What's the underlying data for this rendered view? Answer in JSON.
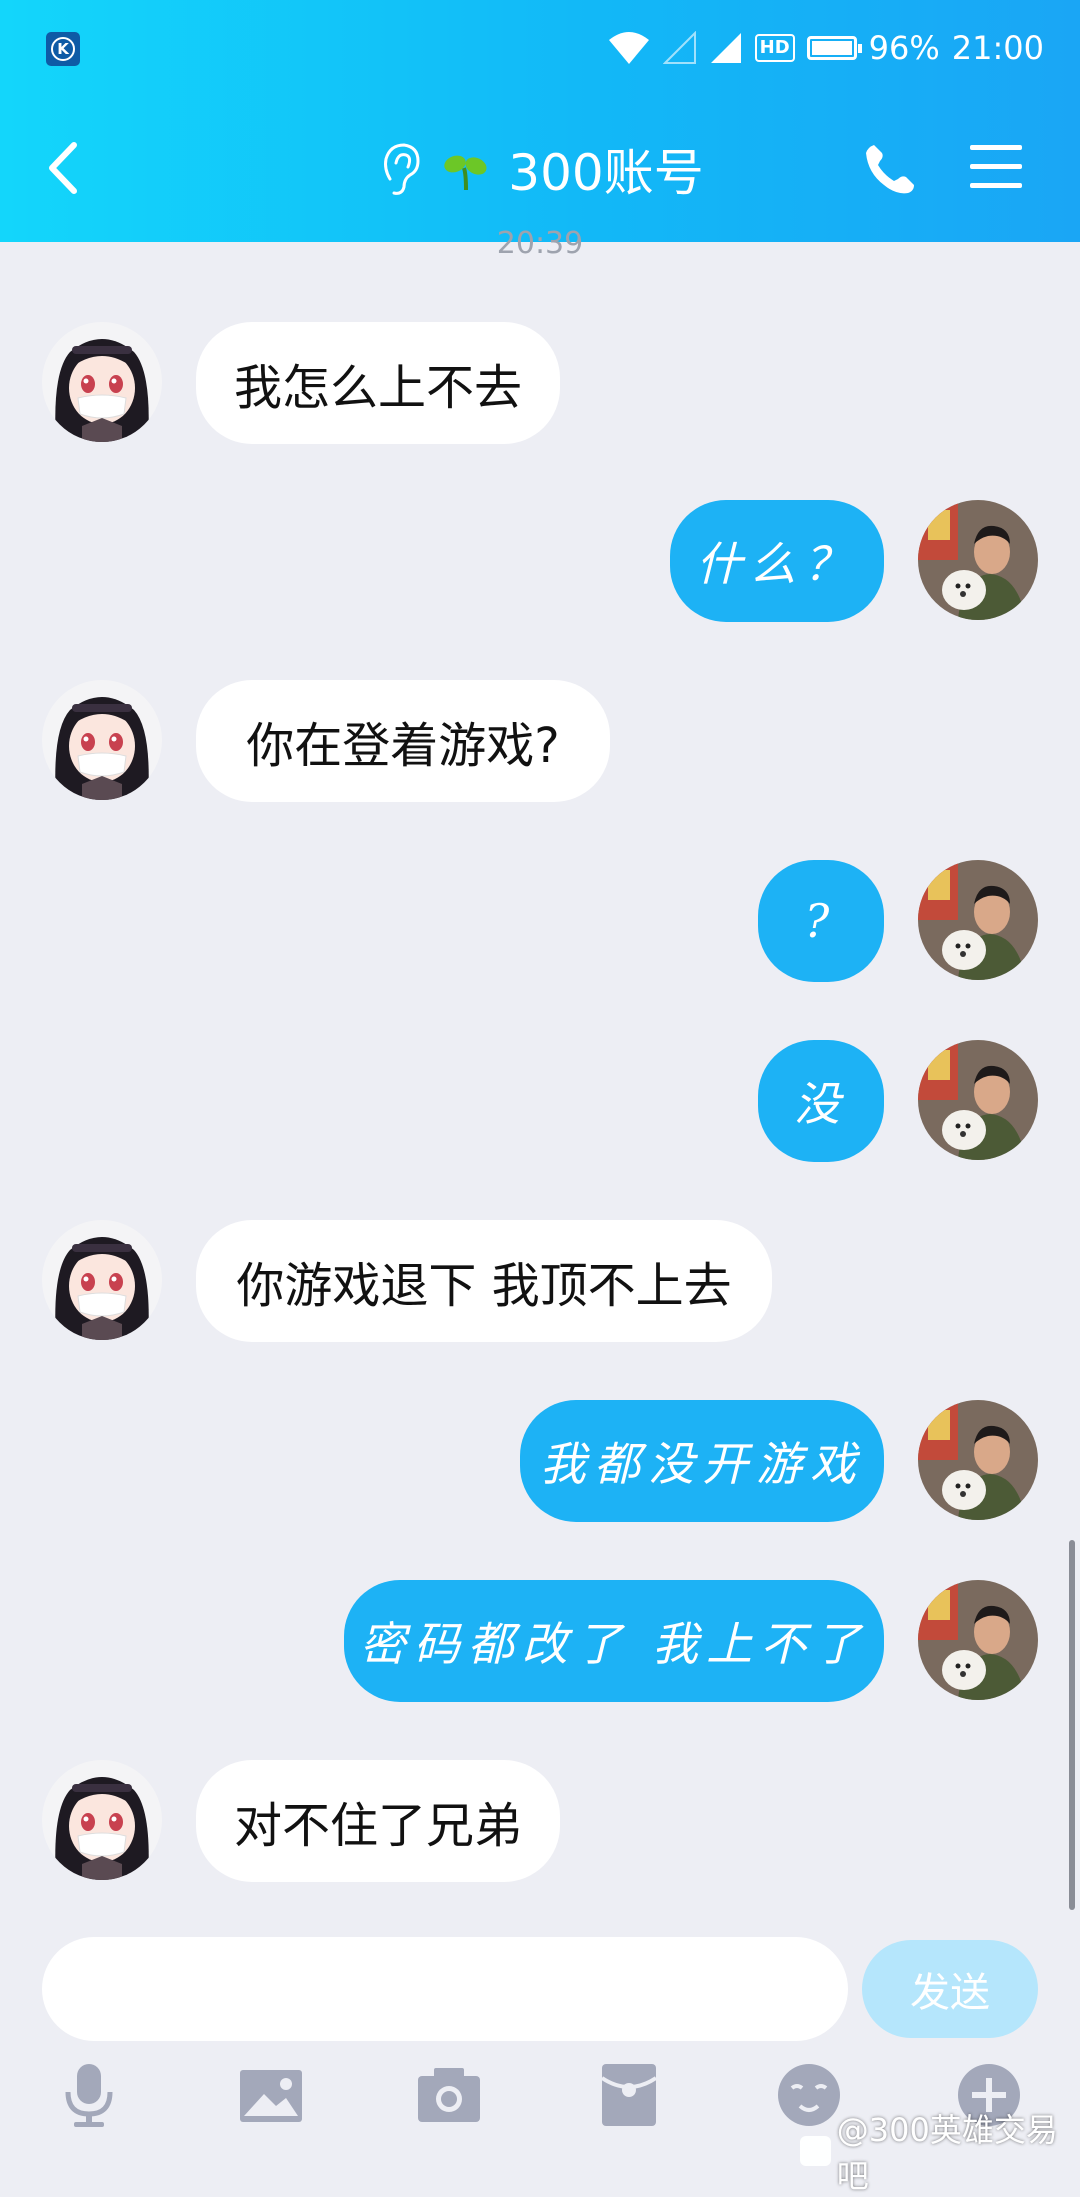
{
  "status_bar": {
    "battery_percent": "96%",
    "time": "21:00",
    "network_badge": "HD"
  },
  "header": {
    "title": "300账号"
  },
  "timestamp": "20:39",
  "messages": [
    {
      "side": "in",
      "text": "我怎么上不去"
    },
    {
      "side": "out",
      "text": "什么？"
    },
    {
      "side": "in",
      "text": "你在登着游戏?"
    },
    {
      "side": "out",
      "text": "?"
    },
    {
      "side": "out",
      "text": "没"
    },
    {
      "side": "in",
      "text": "你游戏退下 我顶不上去"
    },
    {
      "side": "out",
      "text": "我都没开游戏"
    },
    {
      "side": "out",
      "text": "密码都改了  我上不了"
    },
    {
      "side": "in",
      "text": "对不住了兄弟"
    }
  ],
  "composer": {
    "input_value": "",
    "send_label": "发送"
  },
  "toolbar": [
    "microphone-icon",
    "image-icon",
    "camera-icon",
    "red-packet-icon",
    "emoji-icon",
    "plus-icon"
  ],
  "watermark": "@300英雄交易吧",
  "colors": {
    "header_start": "#13D6FB",
    "header_end": "#1AA6F5",
    "outgoing_bubble": "#1DB2F5",
    "incoming_bubble": "#FFFFFF",
    "background": "#EDEEF4",
    "send_button": "#B5E6FC"
  }
}
